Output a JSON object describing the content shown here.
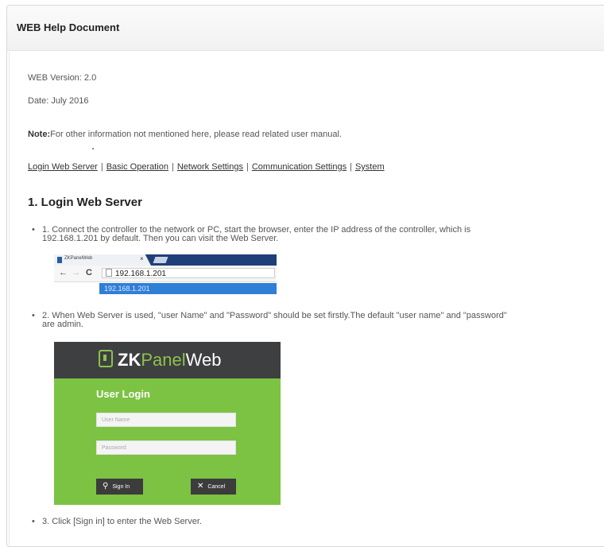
{
  "header": {
    "title": "WEB Help Document"
  },
  "meta": {
    "version": "WEB Version: 2.0",
    "date": "Date: July 2016"
  },
  "note": {
    "label": "Note:",
    "text": "For other information not mentioned here, please read related user manual."
  },
  "nav": {
    "items": [
      "Login Web Server",
      "Basic Operation",
      "Network Settings",
      "Communication Settings",
      "System"
    ],
    "separator": "|"
  },
  "section": {
    "title": "1. Login Web Server",
    "steps": [
      {
        "line1": "1. Connect the controller to the network or PC, start the browser, enter the IP address of the controller, which is",
        "line2": "192.168.1.201 by default. Then you can visit the Web Server."
      },
      {
        "line1": "2. When Web Server is used, \"user Name\" and \"Password\" should be set firstly.The default \"user name\" and \"password\"",
        "line2": "are admin."
      },
      {
        "line1": "3. Click [Sign in] to enter the Web Server."
      }
    ]
  },
  "browser": {
    "tab_title": "ZKPanelWeb",
    "tab_close": "×",
    "back": "←",
    "forward": "→",
    "reload": "C",
    "url": "192.168.1.201",
    "suggestion": "192.168.1.201"
  },
  "login_screen": {
    "brand_zk": "ZK",
    "brand_panel": "Panel",
    "brand_web": "Web",
    "title": "User Login",
    "username_placeholder": "User Name",
    "password_placeholder": "Password",
    "signin_label": "Sign In",
    "cancel_label": "Cancel",
    "key_icon": "key-icon",
    "close_icon": "close-icon"
  },
  "colors": {
    "login_green": "#7cc243",
    "login_header": "#3e3f41",
    "browser_blue": "#1f3f78"
  }
}
